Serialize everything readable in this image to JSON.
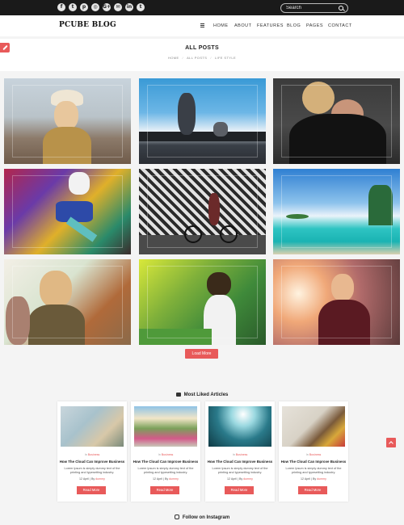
{
  "topbar": {
    "social_icons": [
      {
        "name": "facebook-icon",
        "glyph": "f"
      },
      {
        "name": "twitter-icon",
        "glyph": "t"
      },
      {
        "name": "pinterest-icon",
        "glyph": "p"
      },
      {
        "name": "instagram-icon",
        "glyph": "◎"
      },
      {
        "name": "google-plus-icon",
        "glyph": "G+"
      },
      {
        "name": "email-icon",
        "glyph": "✉"
      },
      {
        "name": "linkedin-icon",
        "glyph": "in"
      },
      {
        "name": "tumblr-icon",
        "glyph": "t"
      }
    ],
    "search_placeholder": "Search"
  },
  "header": {
    "logo": "PCUBE BLOG",
    "nav": [
      "HOME",
      "ABOUT",
      "FEATURES",
      "BLOG",
      "PAGES",
      "CONTACT"
    ]
  },
  "page": {
    "title": "ALL POSTS",
    "breadcrumbs": [
      "HOME",
      "ALL POSTS",
      "LIFE STYLE"
    ]
  },
  "grid": {
    "load_more": "Load More"
  },
  "liked": {
    "title": "Most Liked Articles",
    "articles": [
      {
        "category_prefix": "In",
        "category": "Business",
        "title": "How The Cloud Can Improve Business",
        "excerpt": "Lorem Ipsum is simply dummy text of the printing and typesetting industry.",
        "date": "12 April",
        "by": "By",
        "author": "dummy",
        "button": "Read More"
      },
      {
        "category_prefix": "In",
        "category": "Business",
        "title": "How The Cloud Can Improve Business",
        "excerpt": "Lorem Ipsum is simply dummy text of the printing and typesetting industry.",
        "date": "12 April",
        "by": "By",
        "author": "dummy",
        "button": "Read More"
      },
      {
        "category_prefix": "In",
        "category": "Business",
        "title": "How The Cloud Can Improve Business",
        "excerpt": "Lorem Ipsum is simply dummy text of the printing and typesetting industry.",
        "date": "12 April",
        "by": "By",
        "author": "dummy",
        "button": "Read More"
      },
      {
        "category_prefix": "In",
        "category": "Business",
        "title": "How The Cloud Can Improve Business",
        "excerpt": "Lorem Ipsum is simply dummy text of the printing and typesetting industry.",
        "date": "12 April",
        "by": "By",
        "author": "dummy",
        "button": "Read More"
      }
    ]
  },
  "instagram": {
    "title": "Follow on Instagram"
  },
  "colors": {
    "accent": "#e85a5a",
    "topbar": "#1a1a1a"
  }
}
